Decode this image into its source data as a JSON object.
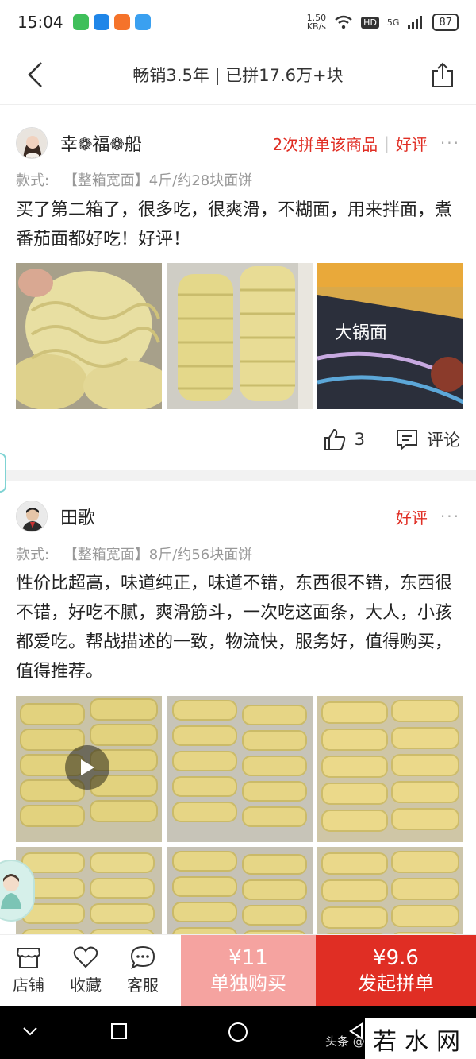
{
  "status_bar": {
    "time": "15:04",
    "net_speed_value": "1.50",
    "net_speed_unit": "KB/s",
    "hd": "HD",
    "signal": "5G",
    "battery": "87"
  },
  "nav": {
    "title": "畅销3.5年 | 已拼17.6万+块"
  },
  "reviews": [
    {
      "name": "幸❁福❁船",
      "repeat_buy": "2次拼单该商品",
      "rating": "好评",
      "spec_label": "款式:",
      "spec_value": "【整箱宽面】4斤/约28块面饼",
      "text": "买了第二箱了，很多吃，很爽滑，不糊面，用来拌面，煮番茄面都好吃！好评！",
      "photos": [
        "noodle-closeup",
        "noodle-box",
        "package-bag"
      ],
      "likes": "3",
      "comment_label": "评论"
    },
    {
      "name": "田歌",
      "rating": "好评",
      "spec_label": "款式:",
      "spec_value": "【整箱宽面】8斤/约56块面饼",
      "text": "性价比超高，味道纯正，味道不错，东西很不错，东西很不错，好吃不腻，爽滑筋斗，一次吃这面条，大人，小孩都爱吃。帮战描述的一致，物流快，服务好，值得购买，值得推荐。",
      "photos": [
        "video-noodles",
        "noodle-rows",
        "noodle-rows",
        "noodle-rows",
        "noodle-rows",
        "noodle-rows"
      ]
    }
  ],
  "bottom_bar": {
    "store_label": "店铺",
    "favorite_label": "收藏",
    "service_label": "客服",
    "single_price": "¥11",
    "single_label": "单独购买",
    "group_price": "¥9.6",
    "group_label": "发起拼单"
  },
  "watermark": {
    "small": "头条 @猫",
    "brand": "若水网"
  },
  "colors": {
    "accent": "#e02e24",
    "accent_light": "#f5a3a0",
    "noodle": "#e8dc9a"
  }
}
